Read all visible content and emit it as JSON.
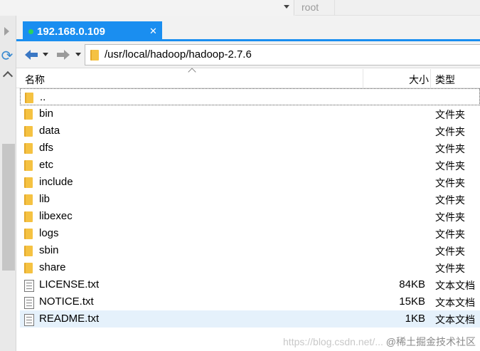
{
  "topbar": {
    "user": "root"
  },
  "tab": {
    "label": "192.168.0.109",
    "close": "✕"
  },
  "address": {
    "path": "/usr/local/hadoop/hadoop-2.7.6"
  },
  "columns": {
    "name": "名称",
    "size": "大小",
    "type": "类型"
  },
  "parent": {
    "name": ".."
  },
  "folders": [
    {
      "name": "bin",
      "type": "文件夹"
    },
    {
      "name": "data",
      "type": "文件夹"
    },
    {
      "name": "dfs",
      "type": "文件夹"
    },
    {
      "name": "etc",
      "type": "文件夹"
    },
    {
      "name": "include",
      "type": "文件夹"
    },
    {
      "name": "lib",
      "type": "文件夹"
    },
    {
      "name": "libexec",
      "type": "文件夹"
    },
    {
      "name": "logs",
      "type": "文件夹"
    },
    {
      "name": "sbin",
      "type": "文件夹"
    },
    {
      "name": "share",
      "type": "文件夹"
    }
  ],
  "files": [
    {
      "name": "LICENSE.txt",
      "size": "84KB",
      "type": "文本文档"
    },
    {
      "name": "NOTICE.txt",
      "size": "15KB",
      "type": "文本文档"
    },
    {
      "name": "README.txt",
      "size": "1KB",
      "type": "文本文档"
    }
  ],
  "watermark": {
    "url": "https://blog.csdn.net/...",
    "brand": "@稀土掘金技术社区"
  },
  "colors": {
    "accent": "#1a8ef0",
    "status_online": "#2bd35c",
    "folder": "#f5c242",
    "selection": "#e5f1fb"
  }
}
